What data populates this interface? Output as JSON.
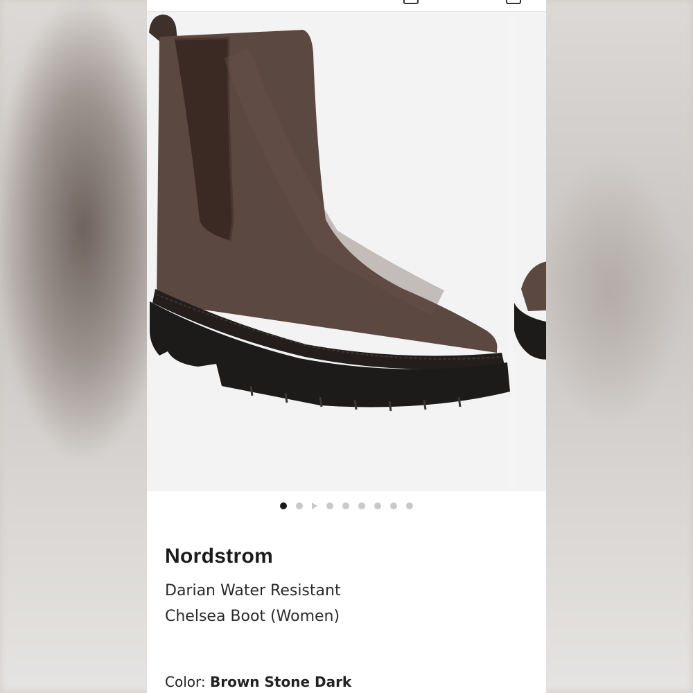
{
  "product": {
    "brand": "Nordstrom",
    "name": "Darian Water Resistant Chelsea Boot (Women)",
    "color_label": "Color:",
    "color_value": "Brown Stone Dark"
  },
  "gallery": {
    "image_count": 9,
    "active_index": 0,
    "video_indicator_index": 2
  },
  "colors": {
    "accent": "#1a1a1a",
    "boot_suede": "#5b4840",
    "sole": "#1d1b1a"
  }
}
